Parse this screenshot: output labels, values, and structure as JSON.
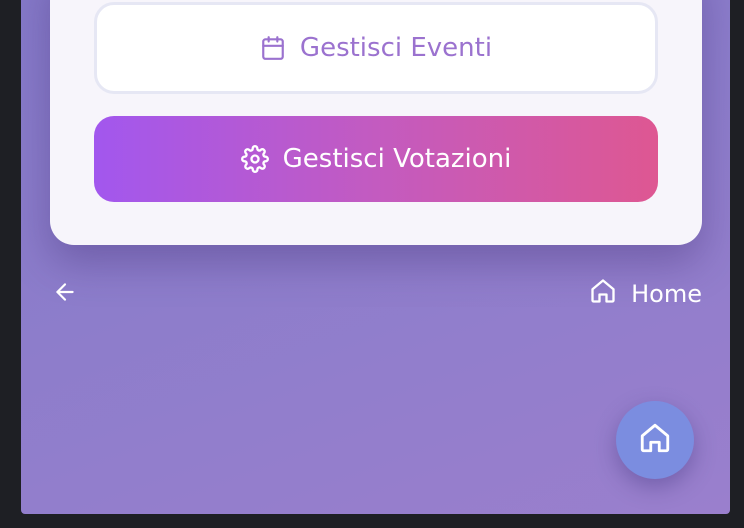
{
  "card": {
    "events_button_label": "Gestisci Eventi",
    "votes_button_label": "Gestisci Votazioni"
  },
  "nav": {
    "home_label": "Home"
  },
  "icons": {
    "events": "calendar-icon",
    "votes": "gear-icon",
    "back": "arrow-left-icon",
    "home": "home-icon",
    "fab": "home-icon"
  },
  "colors": {
    "events_text": "#9b72cf",
    "votes_gradient_start": "#a257ee",
    "votes_gradient_end": "#de5792",
    "fab": "#7b8de0"
  }
}
